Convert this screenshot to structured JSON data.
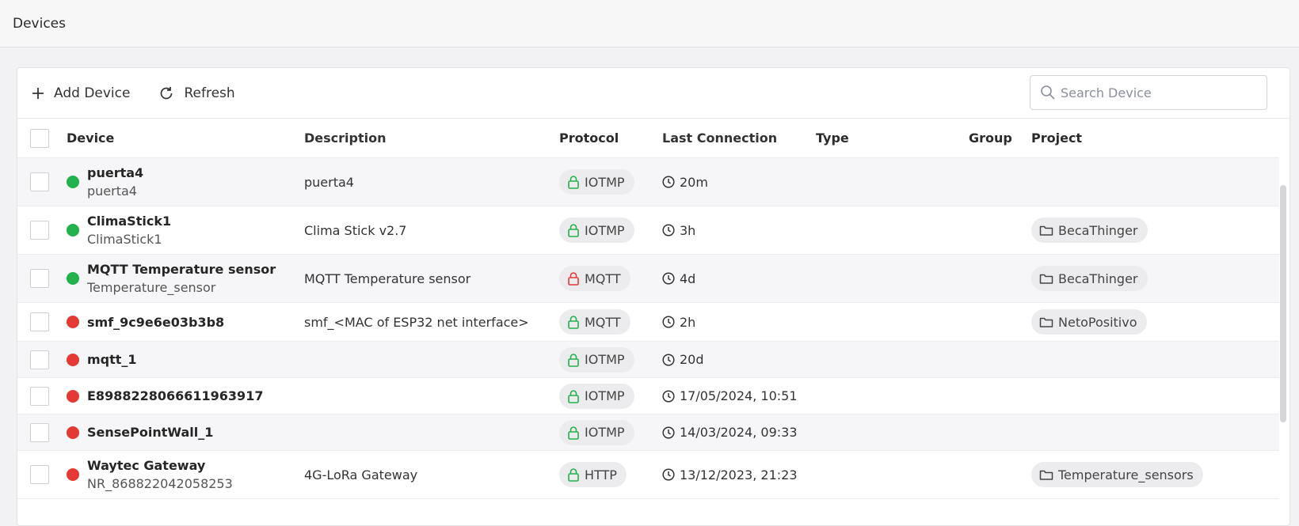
{
  "header": {
    "title": "Devices"
  },
  "toolbar": {
    "add_label": "Add Device",
    "refresh_label": "Refresh"
  },
  "search": {
    "placeholder": "Search Device",
    "value": ""
  },
  "columns": {
    "device": "Device",
    "description": "Description",
    "protocol": "Protocol",
    "last_connection": "Last Connection",
    "type": "Type",
    "group": "Group",
    "project": "Project"
  },
  "colors": {
    "online": "#22b14c",
    "offline": "#e53935",
    "secure_lock": "#22b14c",
    "insecure_lock": "#e53935"
  },
  "rows": [
    {
      "name": "puerta4",
      "id": "puerta4",
      "status": "online",
      "description": "puerta4",
      "protocol": "IOTMP",
      "secure": true,
      "last_connection": "20m",
      "type": "",
      "group": "",
      "project": ""
    },
    {
      "name": "ClimaStick1",
      "id": "ClimaStick1",
      "status": "online",
      "description": "Clima Stick v2.7",
      "protocol": "IOTMP",
      "secure": true,
      "last_connection": "3h",
      "type": "",
      "group": "",
      "project": "BecaThinger"
    },
    {
      "name": "MQTT Temperature sensor",
      "id": "Temperature_sensor",
      "status": "online",
      "description": "MQTT Temperature sensor",
      "protocol": "MQTT",
      "secure": false,
      "last_connection": "4d",
      "type": "",
      "group": "",
      "project": "BecaThinger"
    },
    {
      "name": "smf_9c9e6e03b3b8",
      "id": "",
      "status": "offline",
      "description": "smf_<MAC of ESP32 net interface>",
      "protocol": "MQTT",
      "secure": true,
      "last_connection": "2h",
      "type": "",
      "group": "",
      "project": "NetoPositivo"
    },
    {
      "name": "mqtt_1",
      "id": "",
      "status": "offline",
      "description": "",
      "protocol": "IOTMP",
      "secure": true,
      "last_connection": "20d",
      "type": "",
      "group": "",
      "project": ""
    },
    {
      "name": "E8988228066611963917",
      "id": "",
      "status": "offline",
      "description": "",
      "protocol": "IOTMP",
      "secure": true,
      "last_connection": "17/05/2024, 10:51",
      "type": "",
      "group": "",
      "project": ""
    },
    {
      "name": "SensePointWall_1",
      "id": "",
      "status": "offline",
      "description": "",
      "protocol": "IOTMP",
      "secure": true,
      "last_connection": "14/03/2024, 09:33",
      "type": "",
      "group": "",
      "project": ""
    },
    {
      "name": "Waytec Gateway",
      "id": "NR_868822042058253",
      "status": "offline",
      "description": "4G-LoRa Gateway",
      "protocol": "HTTP",
      "secure": true,
      "last_connection": "13/12/2023, 21:23",
      "type": "",
      "group": "",
      "project": "Temperature_sensors"
    }
  ]
}
